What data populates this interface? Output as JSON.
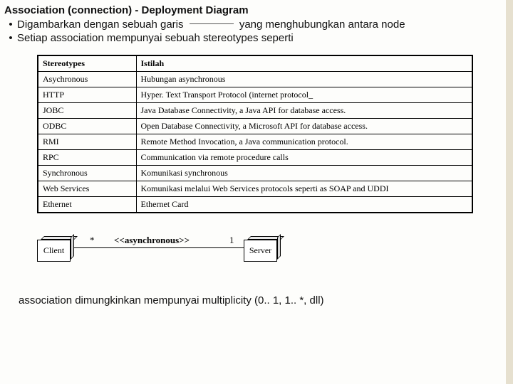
{
  "title": "Association (connection) - Deployment Diagram",
  "bullets": {
    "b1_pre": "Digambarkan dengan sebuah garis",
    "b1_post": "yang menghubungkan antara node",
    "b2": "Setiap association mempunyai sebuah stereotypes seperti"
  },
  "table": {
    "header": {
      "c1": "Stereotypes",
      "c2": "Istilah"
    },
    "rows": [
      {
        "c1": "Asychronous",
        "c2": "Hubungan asynchronous"
      },
      {
        "c1": "HTTP",
        "c2": "Hyper. Text Transport Protocol (internet protocol_"
      },
      {
        "c1": "JOBC",
        "c2": "Java Database Connectivity, a Java API for database access."
      },
      {
        "c1": "ODBC",
        "c2": "Open Database Connectivity, a Microsoft API for database access."
      },
      {
        "c1": "RMI",
        "c2": "Remote Method Invocation, a Java communication protocol."
      },
      {
        "c1": "RPC",
        "c2": "Communication via remote procedure calls"
      },
      {
        "c1": "Synchronous",
        "c2": "Komunikasi synchronous"
      },
      {
        "c1": "Web Services",
        "c2": "Komunikasi melalui Web Services protocols seperti as SOAP and UDDI"
      },
      {
        "c1": "Ethernet",
        "c2": "Ethernet Card"
      }
    ]
  },
  "diagram": {
    "client": "Client",
    "server": "Server",
    "mult_left": "*",
    "mult_right": "1",
    "stereotype": "<<asynchronous>>"
  },
  "footer": "association dimungkinkan mempunyai multiplicity (0.. 1, 1.. *, dll)"
}
